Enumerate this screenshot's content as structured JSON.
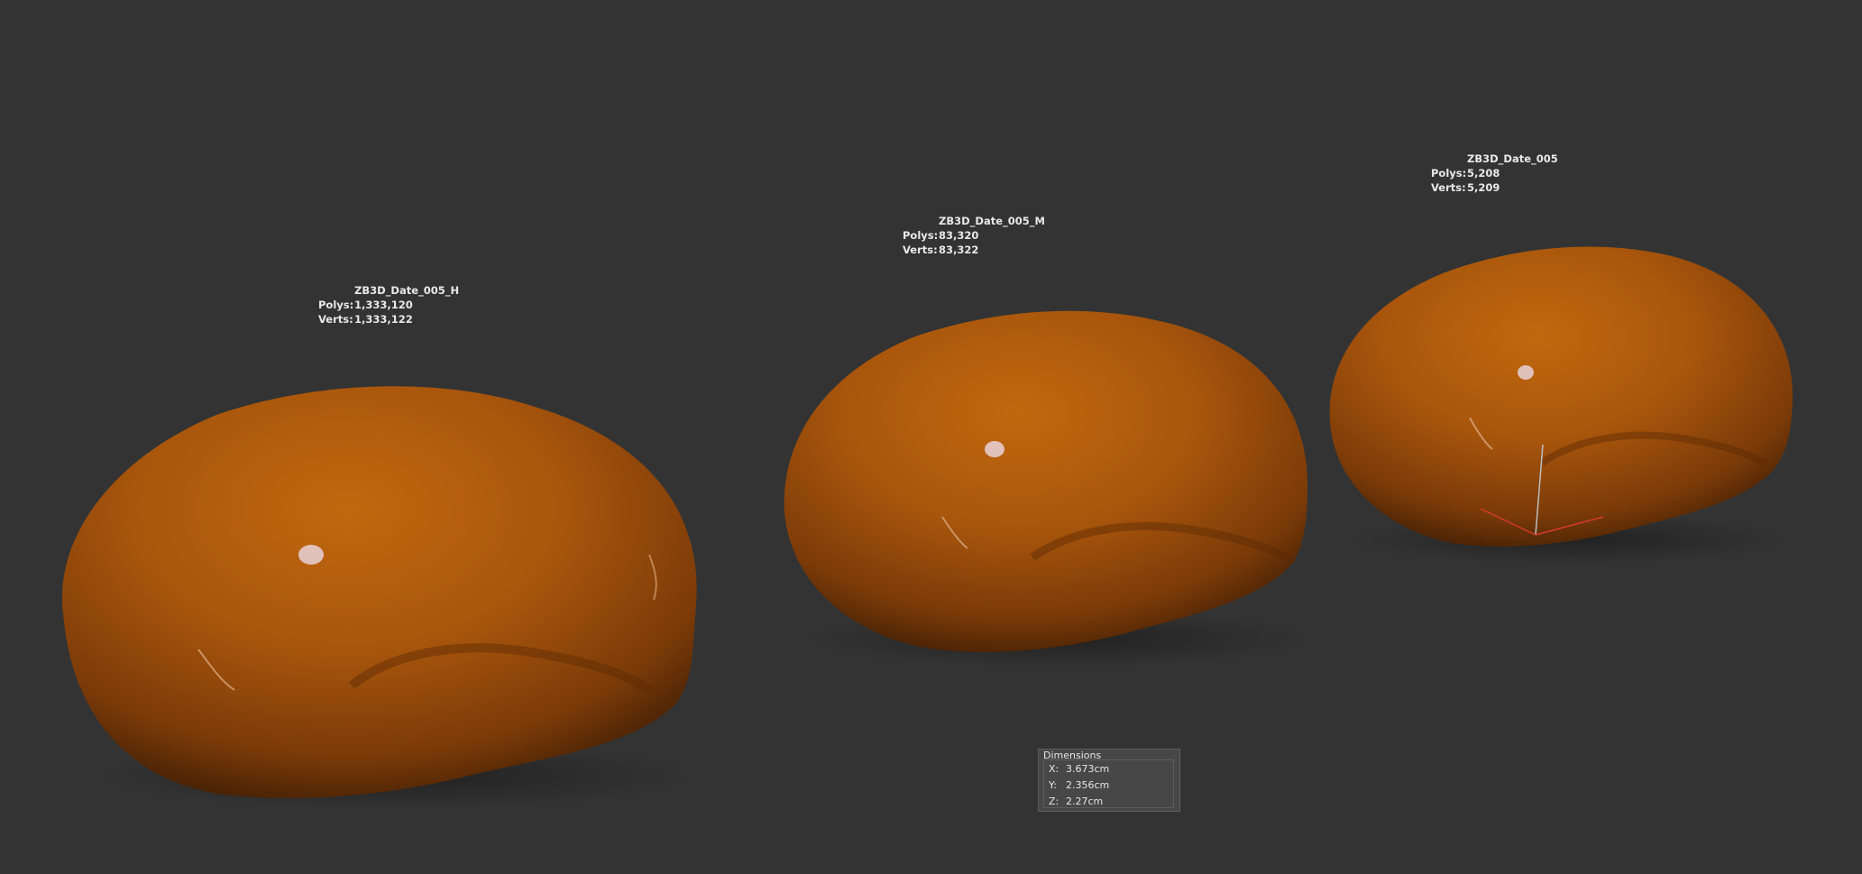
{
  "viewport": {
    "background": "#333333",
    "models": [
      {
        "name": "ZB3D_Date_005_H",
        "polys_label": "Polys:",
        "polys": "1,333,120",
        "verts_label": "Verts:",
        "verts": "1,333,122"
      },
      {
        "name": "ZB3D_Date_005_M",
        "polys_label": "Polys:",
        "polys": "83,320",
        "verts_label": "Verts:",
        "verts": "83,322"
      },
      {
        "name": "ZB3D_Date_005",
        "polys_label": "Polys:",
        "polys": "5,208",
        "verts_label": "Verts:",
        "verts": "5,209"
      }
    ],
    "model_color": "#b05a10",
    "gizmo_icon": "transform-gizmo-icon"
  },
  "dimensions": {
    "title": "Dimensions",
    "x_label": "X:",
    "x": "3.673cm",
    "y_label": "Y:",
    "y": "2.356cm",
    "z_label": "Z:",
    "z": "2.27cm"
  }
}
